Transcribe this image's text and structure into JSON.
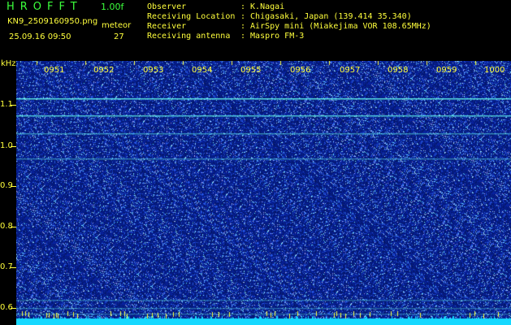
{
  "header": {
    "app_title": "HROFFT",
    "version": "1.00f",
    "filename": "KN9_2509160950.png",
    "meteor_label": "meteor",
    "timestamp": "25.09.16 09:50",
    "meteor_count": "27"
  },
  "info": {
    "observer_label": "Observer",
    "observer_value": ": K.Nagai",
    "location_label": "Receiving Location",
    "location_value": ": Chigasaki, Japan (139.414 35.340)",
    "receiver_label": "Receiver",
    "receiver_value": ": AirSpy mini (Miakejima VOR 108.65MHz)",
    "antenna_label": "Receiving antenna",
    "antenna_value": ": Maspro FM-3"
  },
  "spectrogram": {
    "y_unit": "kHz",
    "y_ticks": [
      "1.1",
      "1.0",
      "0.9",
      "0.8",
      "0.7",
      "0.6"
    ],
    "x_ticks": [
      "0951",
      "0952",
      "0953",
      "0954",
      "0955",
      "0956",
      "0957",
      "0958",
      "0959",
      "1000"
    ],
    "colors": {
      "background": "#0a1a9a",
      "noise": "#3c6cff",
      "line": "#5ff0e8",
      "text_green": "#3cff3c",
      "text_yellow": "#ffff3c",
      "floor": "#16d8ff"
    }
  }
}
